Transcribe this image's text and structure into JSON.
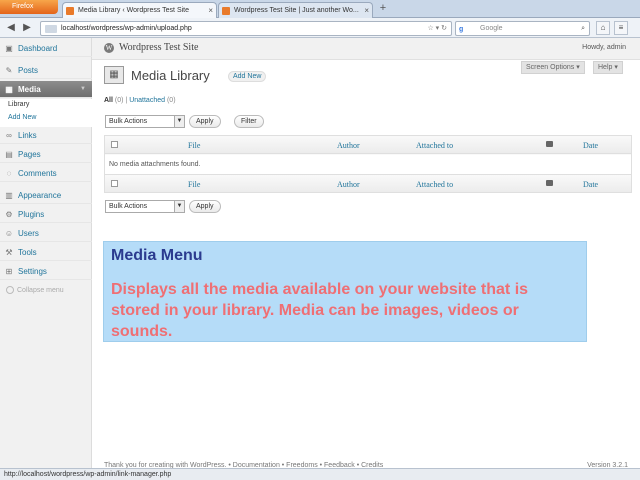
{
  "browser": {
    "app_button": "Firefox",
    "tabs": [
      {
        "label": "Media Library ‹ Wordpress Test Site"
      },
      {
        "label": "Wordpress Test Site | Just another Wo..."
      }
    ],
    "url": "localhost/wordpress/wp-admin/upload.php",
    "search_placeholder": "Google",
    "status_url": "http://localhost/wordpress/wp-admin/link-manager.php"
  },
  "wp": {
    "site_title": "Wordpress Test Site",
    "howdy": "Howdy, admin"
  },
  "sidebar": {
    "items": [
      {
        "label": "Dashboard",
        "icon": "dashboard-icon"
      },
      {
        "label": "Posts",
        "icon": "pin-icon"
      },
      {
        "label": "Media",
        "icon": "media-icon"
      },
      {
        "label": "Links",
        "icon": "link-icon"
      },
      {
        "label": "Pages",
        "icon": "page-icon"
      },
      {
        "label": "Comments",
        "icon": "comment-icon"
      },
      {
        "label": "Appearance",
        "icon": "appearance-icon"
      },
      {
        "label": "Plugins",
        "icon": "plugin-icon"
      },
      {
        "label": "Users",
        "icon": "users-icon"
      },
      {
        "label": "Tools",
        "icon": "tools-icon"
      },
      {
        "label": "Settings",
        "icon": "settings-icon"
      }
    ],
    "submenu": [
      {
        "label": "Library"
      },
      {
        "label": "Add New"
      }
    ],
    "collapse_label": "Collapse menu"
  },
  "main": {
    "title": "Media Library",
    "add_new": "Add New",
    "screen_options": "Screen Options ▾",
    "help": "Help ▾",
    "filters": {
      "all": "All",
      "all_count": "(0)",
      "separator": "|",
      "unattached": "Unattached",
      "unattached_count": "(0)"
    },
    "bulk_actions": "Bulk Actions",
    "apply": "Apply",
    "filter": "Filter",
    "table": {
      "columns": [
        "File",
        "Author",
        "Attached to",
        "Date"
      ],
      "empty_message": "No media attachments found."
    }
  },
  "overlay": {
    "title": "Media Menu",
    "text": "Displays all the media available on your website that is stored in your library.  Media can be images, videos or sounds."
  },
  "footer": {
    "left": "Thank you for creating with WordPress. • Documentation • Freedoms • Feedback • Credits",
    "version": "Version 3.2.1"
  },
  "colors": {
    "link": "#21759b",
    "overlay_bg": "#b5dcf8",
    "overlay_title": "#2b3b8f",
    "overlay_text": "#ef6f74",
    "menu_current": "#7a7a7a"
  }
}
